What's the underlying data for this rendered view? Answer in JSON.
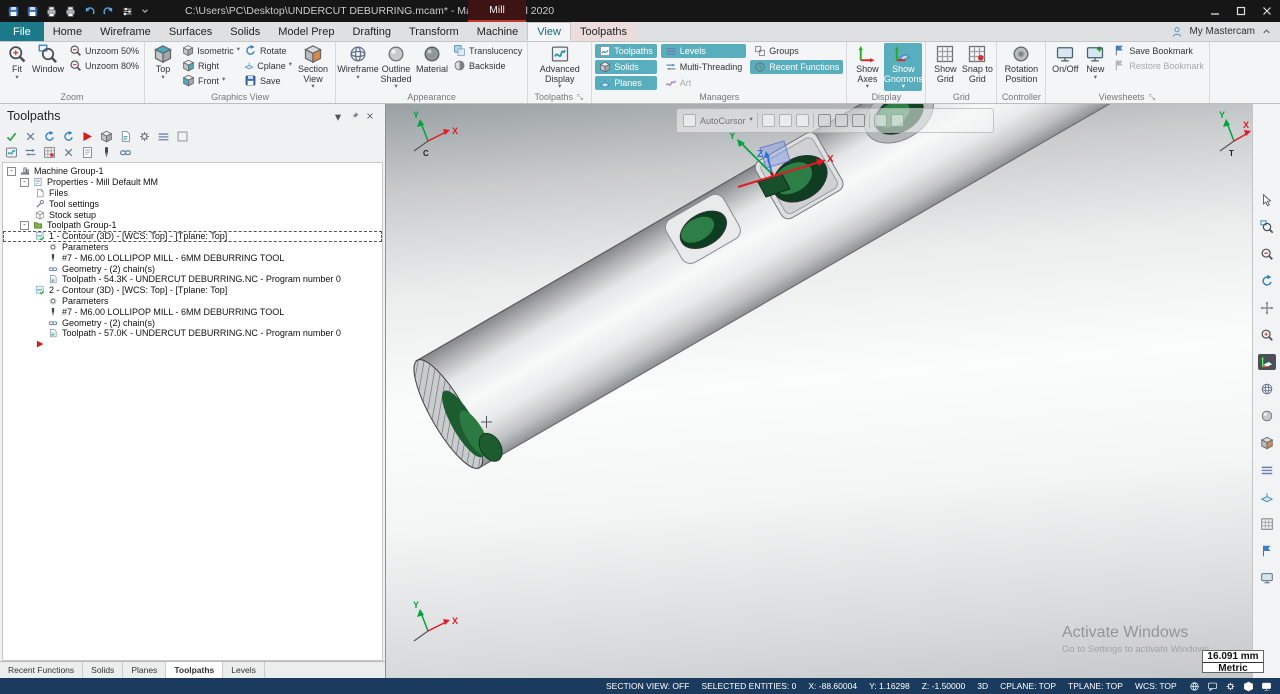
{
  "window": {
    "title": "C:\\Users\\PC\\Desktop\\UNDERCUT DEBURRING.mcam* - Mastercam Mill 2020",
    "context_label": "Mill",
    "quick_access": [
      "save-icon",
      "save-all-icon",
      "print-icon",
      "print-preview-icon",
      "undo-icon",
      "redo-icon",
      "customize-icon",
      "menu-down-icon"
    ]
  },
  "ribbon": {
    "tabs": [
      {
        "label": "File",
        "type": "file"
      },
      {
        "label": "Home"
      },
      {
        "label": "Wireframe"
      },
      {
        "label": "Surfaces"
      },
      {
        "label": "Solids"
      },
      {
        "label": "Model Prep"
      },
      {
        "label": "Drafting"
      },
      {
        "label": "Transform"
      },
      {
        "label": "Machine"
      },
      {
        "label": "View",
        "active": true
      },
      {
        "label": "Toolpaths",
        "contextual": true
      }
    ],
    "account_label": "My Mastercam",
    "zoom": {
      "label": "Zoom",
      "fit": "Fit",
      "window": "Window",
      "unzoom50": "Unzoom 50%",
      "unzoom80": "Unzoom 80%"
    },
    "graphics": {
      "label": "Graphics View",
      "top": "Top",
      "isometric": "Isometric",
      "rotate": "Rotate",
      "right": "Right",
      "cplane": "Cplane",
      "front": "Front",
      "save": "Save",
      "section": "Section View"
    },
    "appearance": {
      "label": "Appearance",
      "wireframe": "Wireframe",
      "outline": "Outline Shaded",
      "material": "Material",
      "translucency": "Translucency",
      "backside": "Backside"
    },
    "toolpaths_group": {
      "label": "Toolpaths",
      "advanced": "Advanced Display"
    },
    "managers": {
      "label": "Managers",
      "items": [
        {
          "label": "Toolpaths",
          "icon": "toolpaths-manager-icon",
          "active": true,
          "col": 0
        },
        {
          "label": "Solids",
          "icon": "solids-manager-icon",
          "active": true,
          "col": 0
        },
        {
          "label": "Planes",
          "icon": "planes-manager-icon",
          "active": true,
          "col": 0
        },
        {
          "label": "Levels",
          "icon": "levels-manager-icon",
          "active": true,
          "col": 1
        },
        {
          "label": "Multi-Threading",
          "icon": "multi-threading-icon",
          "active": false,
          "col": 1
        },
        {
          "label": "Art",
          "icon": "art-icon",
          "active": false,
          "disabled": true,
          "col": 1
        },
        {
          "label": "Groups",
          "icon": "groups-icon",
          "active": false,
          "col": 2
        },
        {
          "label": "Recent Functions",
          "icon": "recent-functions-icon",
          "active": true,
          "col": 2
        }
      ]
    },
    "display": {
      "label": "Display",
      "show_axes": "Show Axes",
      "show_gnomons": "Show Gnomons"
    },
    "grid": {
      "label": "Grid",
      "show_grid": "Show Grid",
      "snap_to_grid": "Snap to Grid"
    },
    "controller": {
      "label": "Controller",
      "rotation_position": "Rotation Position"
    },
    "viewsheets": {
      "label": "Viewsheets",
      "onoff": "On/Off",
      "new": "New",
      "save_bookmark": "Save Bookmark",
      "restore_bookmark": "Restore Bookmark"
    }
  },
  "panel": {
    "title": "Toolpaths",
    "toolbar_row1": [
      "select-all-icon",
      "select-none-icon",
      "regen-selected-icon",
      "regen-all-icon",
      "backplot-icon",
      "verify-icon",
      "post-icon",
      "highfeed-icon",
      "sort-icon",
      "lock-icon"
    ],
    "toolbar_row2": [
      "toggle-toolpath-display-icon",
      "toggle-rapid-icon",
      "toggle-endpoints-icon",
      "delete-operations-icon",
      "parameters-edit-icon",
      "tool-edit-icon",
      "geometry-edit-icon"
    ],
    "tree": [
      {
        "depth": 0,
        "label": "Machine Group-1",
        "icon": "machine-group",
        "exp": true
      },
      {
        "depth": 1,
        "label": "Properties - Mill Default MM",
        "icon": "properties",
        "exp": true
      },
      {
        "depth": 2,
        "label": "Files",
        "icon": "files"
      },
      {
        "depth": 2,
        "label": "Tool settings",
        "icon": "tool-settings"
      },
      {
        "depth": 2,
        "label": "Stock setup",
        "icon": "stock-setup"
      },
      {
        "depth": 1,
        "label": "Toolpath Group-1",
        "icon": "toolpath-group",
        "exp": true
      },
      {
        "depth": 2,
        "label": "1 - Contour (3D) - [WCS: Top] - [Tplane: Top]",
        "icon": "operation",
        "selected": true
      },
      {
        "depth": 3,
        "label": "Parameters",
        "icon": "parameters"
      },
      {
        "depth": 3,
        "label": "#7 - M6.00 LOLLIPOP MILL - 6MM DEBURRING TOOL",
        "icon": "tool"
      },
      {
        "depth": 3,
        "label": "Geometry - (2) chain(s)",
        "icon": "geometry"
      },
      {
        "depth": 3,
        "label": "Toolpath - 54.3K - UNDERCUT DEBURRING.NC - Program number 0",
        "icon": "toolpath-file"
      },
      {
        "depth": 2,
        "label": "2 - Contour (3D) - [WCS: Top] - [Tplane: Top]",
        "icon": "operation"
      },
      {
        "depth": 3,
        "label": "Parameters",
        "icon": "parameters"
      },
      {
        "depth": 3,
        "label": "#7 - M6.00 LOLLIPOP MILL - 6MM DEBURRING TOOL",
        "icon": "tool"
      },
      {
        "depth": 3,
        "label": "Geometry - (2) chain(s)",
        "icon": "geometry"
      },
      {
        "depth": 3,
        "label": "Toolpath - 57.0K - UNDERCUT DEBURRING.NC - Program number 0",
        "icon": "toolpath-file"
      },
      {
        "depth": 2,
        "label": "",
        "icon": "insert-arrow"
      }
    ],
    "tabs": [
      "Recent Functions",
      "Solids",
      "Planes",
      "Toolpaths",
      "Levels"
    ],
    "active_tab": "Toolpaths"
  },
  "viewport": {
    "overlay_label": "AutoCursor",
    "gnomons": {
      "top_left": "C",
      "top_right": "T"
    },
    "axis_labels": {
      "x": "X",
      "y": "Y",
      "z": "Z"
    },
    "scale_readout": {
      "value": "16.091 mm",
      "units": "Metric"
    },
    "watermark": [
      "Activate Windows",
      "Go to Settings to activate Windows"
    ]
  },
  "right_toolbar": {
    "icons": [
      "selection-arrow-icon",
      "zoom-window-icon",
      "unzoom-icon",
      "dynamic-rotate-icon",
      "pan-icon",
      "fit-icon",
      "gnomon-toggle-icon",
      "wireframe-display-icon",
      "shaded-display-icon",
      "section-view-icon",
      "levels-panel-icon",
      "planes-panel-icon",
      "grid-toggle-icon",
      "bookmark-icon",
      "repaint-icon"
    ],
    "active_icon": "gnomon-toggle-icon"
  },
  "status_bar": {
    "items": [
      "SECTION VIEW: OFF",
      "SELECTED ENTITIES: 0",
      "X: -88.60004",
      "Y: 1.16298",
      "Z: -1.50000",
      "3D",
      "CPLANE: TOP",
      "TPLANE: TOP",
      "WCS: TOP"
    ],
    "icons": [
      "globe-icon",
      "chat-icon",
      "gear-icon",
      "cube-icon",
      "monitor-icon",
      "person-icon",
      "wrench-icon"
    ]
  },
  "colors": {
    "accent": "#1a8b9d",
    "toggle_highlight": "#58aebc",
    "axis_x": "#e01b24",
    "axis_y": "#00a33e",
    "axis_z": "#2a6fd4",
    "status_bg": "#1b3b5e",
    "part_green_dark": "#0f3d20",
    "part_green": "#2d7f47"
  }
}
